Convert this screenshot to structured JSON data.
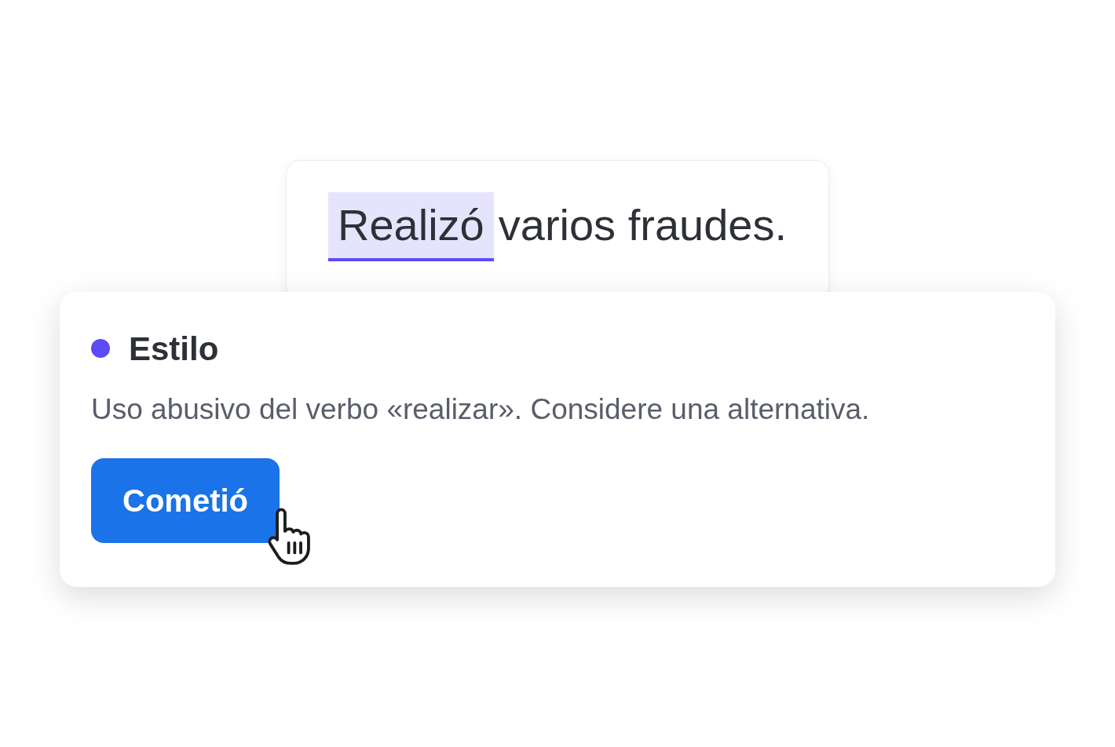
{
  "sentence": {
    "highlighted": "Realizó",
    "rest": "varios fraudes."
  },
  "suggestion": {
    "category": "Estilo",
    "color": "#5b4cf5",
    "message": "Uso abusivo del verbo «realizar». Considere una alternativa.",
    "button": "Cometió"
  }
}
